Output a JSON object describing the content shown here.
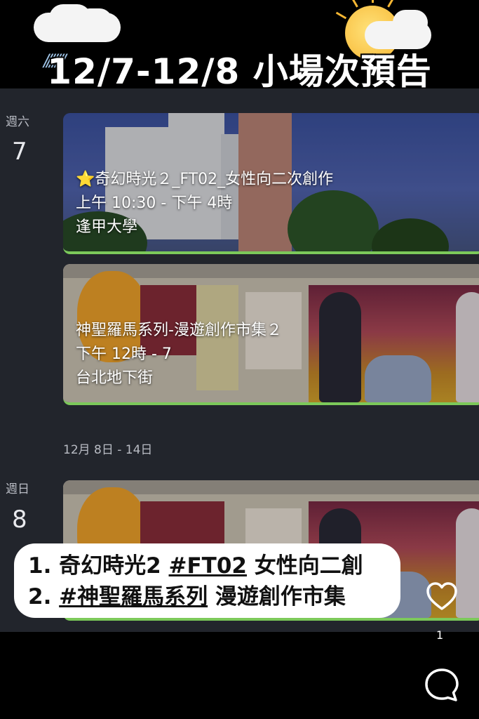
{
  "header": {
    "title": "12/7-12/8 小場次預告"
  },
  "calendar": {
    "day1": {
      "weekday": "週六",
      "date": "7"
    },
    "day2": {
      "weekday": "週日",
      "date": "8"
    },
    "week_range": "12月 8日 - 14日",
    "events": [
      {
        "title": "⭐奇幻時光２_FT02_女性向二次創作",
        "time": "上午 10:30 - 下午 4時",
        "location": "逢甲大學"
      },
      {
        "title": "神聖羅馬系列-漫遊創作市集２",
        "time": "下午 12時 - 7",
        "location": "台北地下街"
      }
    ]
  },
  "overlay": {
    "line1_prefix": "1. 奇幻時光2 ",
    "line1_tag": "#FT02",
    "line1_suffix": " 女性向二創",
    "line2_prefix": "2. ",
    "line2_tag": "#神聖羅馬系列",
    "line2_suffix": " 漫遊創作市集"
  },
  "actions": {
    "like_count": "1",
    "heart_icon": "heart-icon",
    "reply_icon": "speech-bubble-icon"
  },
  "colors": {
    "accent_green": "#7cc95a",
    "calendar_bg": "#22252c"
  }
}
